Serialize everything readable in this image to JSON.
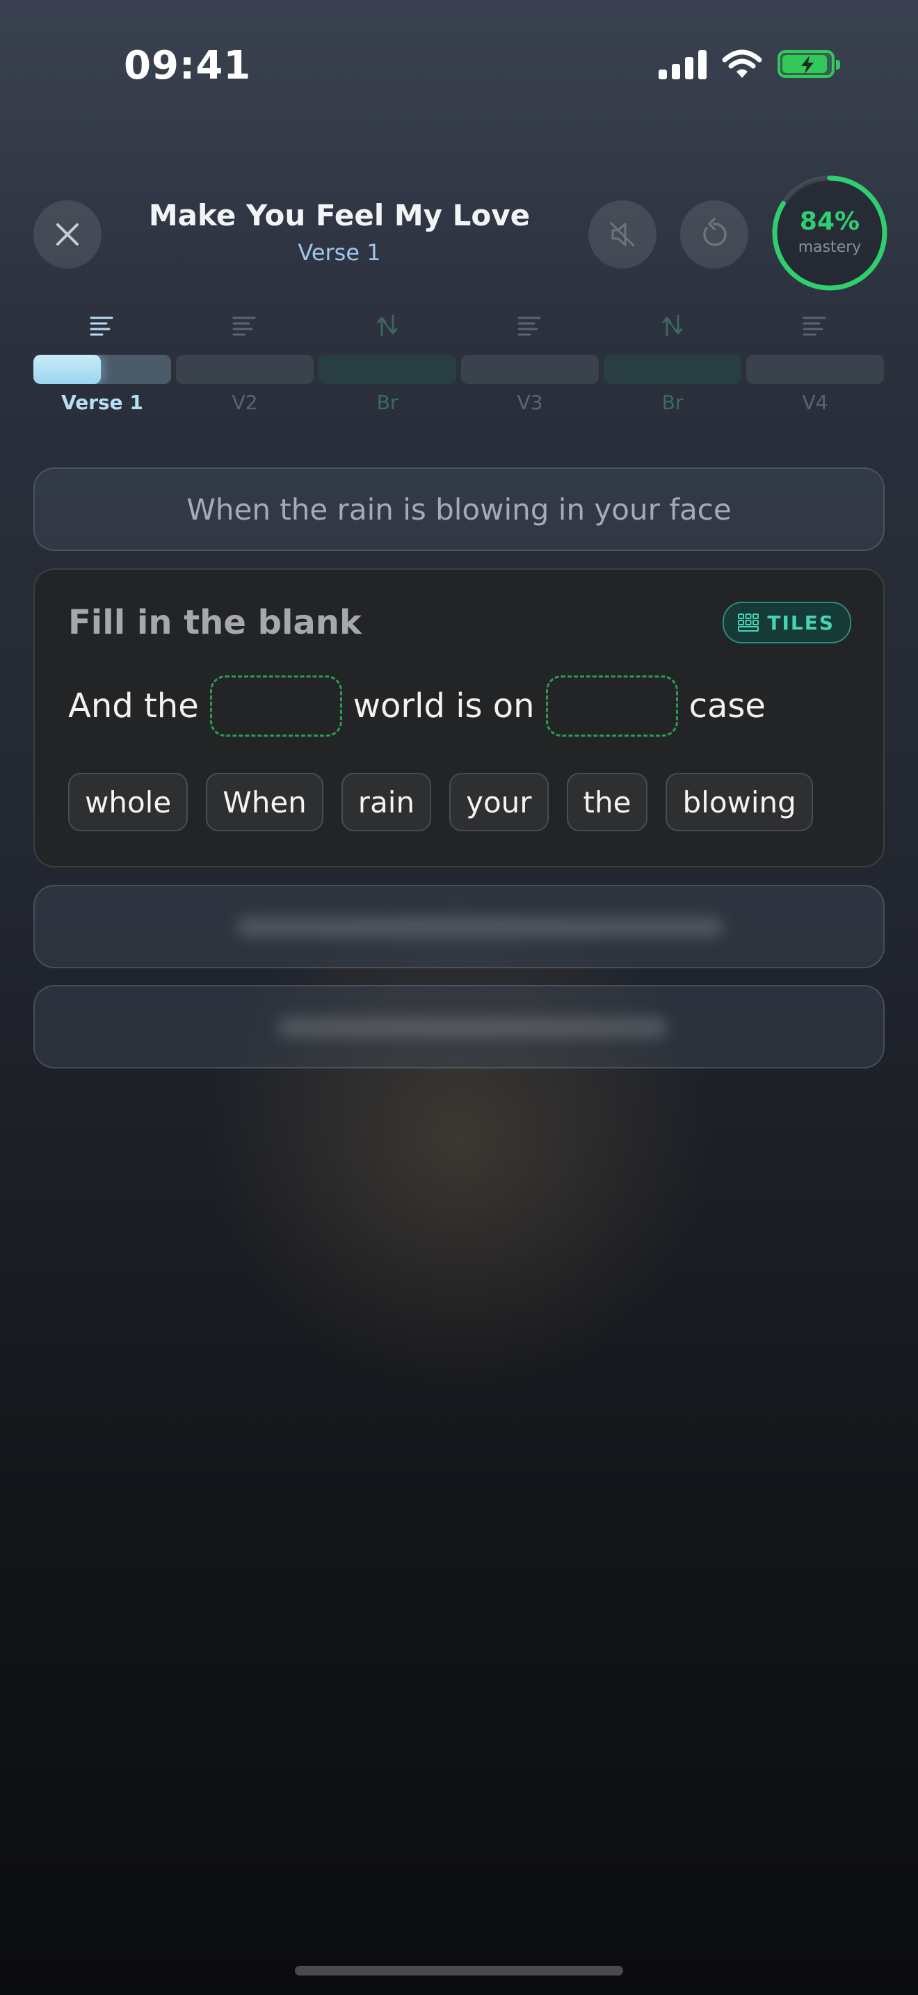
{
  "status_bar": {
    "time": "09:41",
    "icons": [
      "signal-icon",
      "wifi-icon",
      "battery-charging-icon"
    ]
  },
  "header": {
    "title": "Make You Feel My Love",
    "subtitle": "Verse 1",
    "mastery_percent": 84,
    "mastery_value": "84%",
    "mastery_label": "mastery",
    "icons": [
      "close-icon",
      "speaker-muted-icon",
      "restart-icon"
    ]
  },
  "sections": [
    {
      "label": "Verse 1",
      "kind": "verse",
      "active": true,
      "progress": 0.49
    },
    {
      "label": "V2",
      "kind": "verse",
      "active": false,
      "progress": 0
    },
    {
      "label": "Br",
      "kind": "bridge",
      "active": false,
      "progress": 0
    },
    {
      "label": "V3",
      "kind": "verse",
      "active": false,
      "progress": 0
    },
    {
      "label": "Br",
      "kind": "bridge",
      "active": false,
      "progress": 0
    },
    {
      "label": "V4",
      "kind": "verse",
      "active": false,
      "progress": 0
    }
  ],
  "previous_line": "When the rain is blowing in your face",
  "exercise": {
    "title": "Fill in the blank",
    "mode_badge": "TILES",
    "sentence": {
      "part1": "And the",
      "part2": "world is on",
      "part3": "case"
    },
    "tiles": [
      "whole",
      "When",
      "rain",
      "your",
      "the",
      "blowing"
    ]
  },
  "colors": {
    "accent_green": "#2fcf6f",
    "accent_teal": "#49d3b6",
    "accent_blue": "#9dc8ea"
  }
}
